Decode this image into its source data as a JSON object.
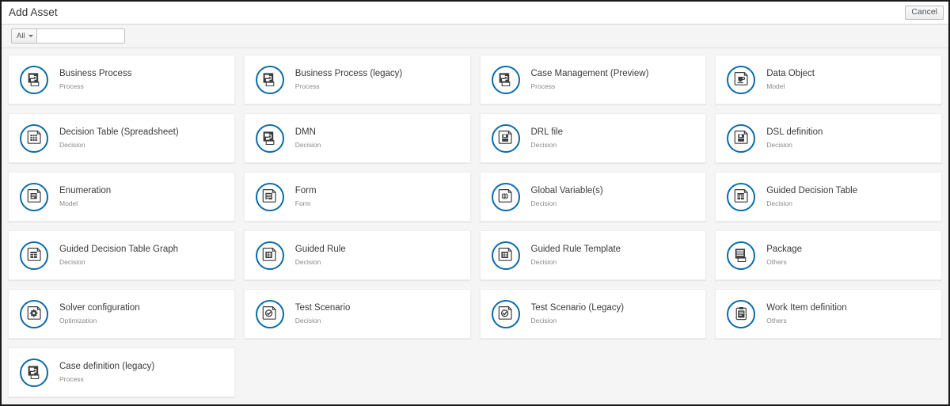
{
  "header": {
    "title": "Add Asset",
    "cancel_label": "Cancel"
  },
  "filter": {
    "select_label": "All",
    "select_options": [
      "All"
    ],
    "search_value": "",
    "search_placeholder": ""
  },
  "colors": {
    "accent_blue": "#0b6ba8",
    "icon_dark": "#3c3c3c",
    "page_bg": "#f5f5f5",
    "card_bg": "#ffffff",
    "card_border": "#ededed",
    "title_text": "#3b3b3b",
    "category_text": "#8a8a8a"
  },
  "assets": [
    {
      "title": "Business Process",
      "category": "Process",
      "icon": "process-diagram-icon"
    },
    {
      "title": "Business Process (legacy)",
      "category": "Process",
      "icon": "process-diagram-icon"
    },
    {
      "title": "Case Management (Preview)",
      "category": "Process",
      "icon": "process-diagram-icon"
    },
    {
      "title": "Data Object",
      "category": "Model",
      "icon": "java-object-icon"
    },
    {
      "title": "Decision Table (Spreadsheet)",
      "category": "Decision",
      "icon": "spreadsheet-icon"
    },
    {
      "title": "DMN",
      "category": "Decision",
      "icon": "process-diagram-icon"
    },
    {
      "title": "DRL file",
      "category": "Decision",
      "icon": "drl-file-icon"
    },
    {
      "title": "DSL definition",
      "category": "Decision",
      "icon": "drl-file-icon"
    },
    {
      "title": "Enumeration",
      "category": "Model",
      "icon": "enumeration-icon"
    },
    {
      "title": "Form",
      "category": "Form",
      "icon": "form-icon"
    },
    {
      "title": "Global Variable(s)",
      "category": "Decision",
      "icon": "globe-icon"
    },
    {
      "title": "Guided Decision Table",
      "category": "Decision",
      "icon": "guided-table-icon"
    },
    {
      "title": "Guided Decision Table Graph",
      "category": "Decision",
      "icon": "guided-table-icon"
    },
    {
      "title": "Guided Rule",
      "category": "Decision",
      "icon": "guided-rule-icon"
    },
    {
      "title": "Guided Rule Template",
      "category": "Decision",
      "icon": "guided-rule-icon"
    },
    {
      "title": "Package",
      "category": "Others",
      "icon": "package-icon"
    },
    {
      "title": "Solver configuration",
      "category": "Optimization",
      "icon": "gear-doc-icon"
    },
    {
      "title": "Test Scenario",
      "category": "Decision",
      "icon": "check-doc-icon"
    },
    {
      "title": "Test Scenario (Legacy)",
      "category": "Decision",
      "icon": "check-doc-icon"
    },
    {
      "title": "Work Item definition",
      "category": "Others",
      "icon": "clipboard-icon"
    },
    {
      "title": "Case definition (legacy)",
      "category": "Process",
      "icon": "process-diagram-icon"
    }
  ]
}
